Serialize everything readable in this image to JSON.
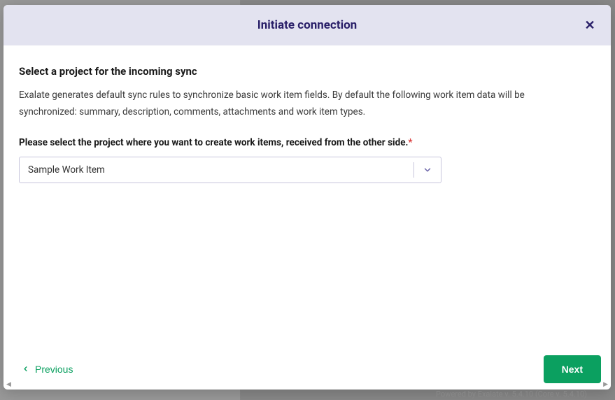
{
  "modal": {
    "title": "Initiate connection",
    "close_label": "✕"
  },
  "content": {
    "section_title": "Select a project for the incoming sync",
    "section_desc": "Exalate generates default sync rules to synchronize basic work item fields. By default the following work item data will be synchronized: summary, description, comments, attachments and work item types.",
    "field_label": "Please select the project where you want to create work items, received from the other side.",
    "required_mark": "*",
    "selected_project": "Sample Work Item"
  },
  "footer": {
    "previous_label": "Previous",
    "next_label": "Next"
  },
  "bg": {
    "powered": "Powered by Exalate v. 5.4.10 (Core v. 5.4.10)"
  }
}
